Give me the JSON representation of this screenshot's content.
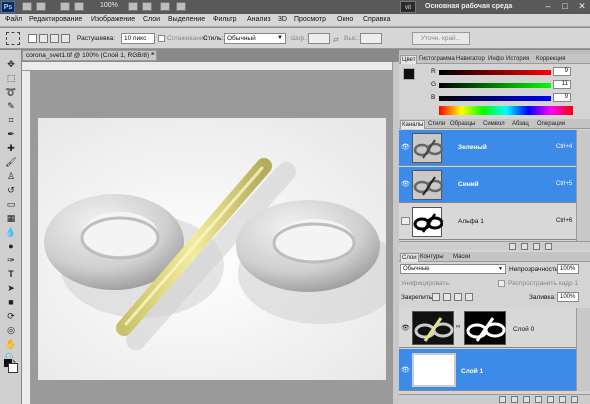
{
  "app": {
    "logo": "Ps",
    "zoom": "100%",
    "workspace_box": "vit",
    "workspace_name": "Основная рабочая среда",
    "window_buttons": [
      "–",
      "□",
      "✕"
    ]
  },
  "menu": [
    "Файл",
    "Редактирование",
    "Изображение",
    "Слои",
    "Выделение",
    "Фильтр",
    "Анализ",
    "3D",
    "Просмотр",
    "Окно",
    "Справка"
  ],
  "options": {
    "feather_label": "Растушевка:",
    "feather_value": "10 пикс",
    "antialias_label": "Сглаживание",
    "style_label": "Стиль:",
    "style_value": "Обычный",
    "width_label": "Шир.:",
    "height_label": "Выс.:",
    "refine_button": "Уточн. край..."
  },
  "document": {
    "tab_title": "corona_svet1.tif @ 100% (Слой 1, RGB/8) *",
    "close": "×"
  },
  "colors": {
    "accent": "#3d8be8",
    "pencil": "#e7e08a",
    "torus": "#d4d4d4"
  },
  "color_panel": {
    "tabs": [
      "Цвет",
      "Гистограмма",
      "Навигатор",
      "Инфо",
      "История",
      "Коррекция"
    ],
    "sliders": [
      {
        "label": "R",
        "value": "9"
      },
      {
        "label": "G",
        "value": "11"
      },
      {
        "label": "B",
        "value": "9"
      }
    ]
  },
  "channels_panel": {
    "tabs": [
      "Каналы",
      "Стили",
      "Образцы",
      "Символ",
      "Абзац",
      "Операции"
    ],
    "rows": [
      {
        "name": "Зеленый",
        "shortcut": "Ctrl+4"
      },
      {
        "name": "Синий",
        "shortcut": "Ctrl+5"
      },
      {
        "name": "Альфа 1",
        "shortcut": "Ctrl+6"
      }
    ]
  },
  "layers_panel": {
    "tabs": [
      "Слои",
      "Контуры",
      "Маски"
    ],
    "blend_mode": "Обычные",
    "opacity_label": "Непрозрачность:",
    "opacity_value": "100%",
    "unify_label": "Унифицировать:",
    "propagate_label": "Распространить кадр 1",
    "lock_label": "Закрепить:",
    "fill_label": "Заливка:",
    "fill_value": "100%",
    "layers": [
      {
        "name": "Слой 0"
      },
      {
        "name": "Слой 1"
      }
    ]
  }
}
